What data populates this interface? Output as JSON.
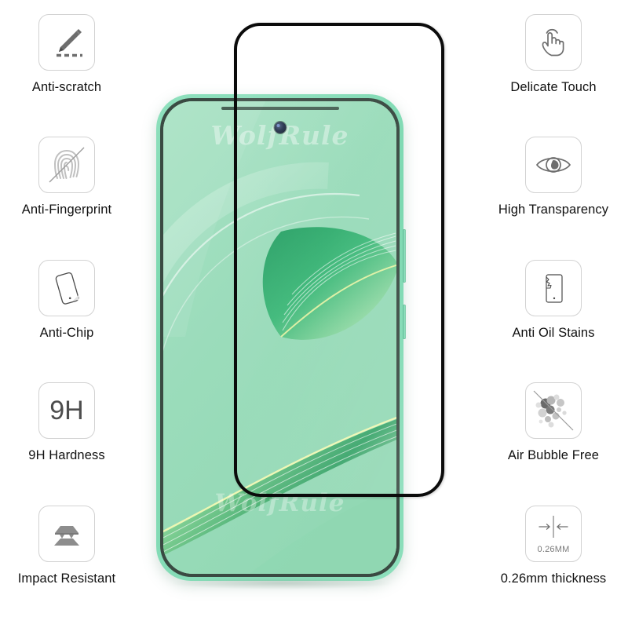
{
  "product": {
    "type": "tempered-glass-screen-protector",
    "brand_watermark": "WolfRule",
    "watermark_top": "WolfRule",
    "watermark_bottom": "WolfRule"
  },
  "colors": {
    "phone_green": "#8fe0bd",
    "screen_green": "#a5dfc0",
    "protector_edge": "#0b0b0b",
    "icon_border": "#d2d2d2",
    "icon_gray": "#6e6e6e",
    "label_text": "#111111"
  },
  "left_features": [
    {
      "icon": "scratch-pen-icon",
      "label": "Anti-scratch"
    },
    {
      "icon": "fingerprint-icon",
      "label": "Anti-Fingerprint"
    },
    {
      "icon": "phone-chip-icon",
      "label": "Anti-Chip"
    },
    {
      "icon": "hardness-9h-icon",
      "label": "9H Hardness",
      "badge": "9H"
    },
    {
      "icon": "impact-layers-icon",
      "label": "Impact Resistant"
    }
  ],
  "right_features": [
    {
      "icon": "touch-hand-icon",
      "label": "Delicate Touch"
    },
    {
      "icon": "eye-icon",
      "label": "High Transparency"
    },
    {
      "icon": "oil-stain-phone-icon",
      "label": "Anti Oil Stains"
    },
    {
      "icon": "air-bubble-icon",
      "label": "Air Bubble Free"
    },
    {
      "icon": "thickness-icon",
      "label": "0.26mm thickness",
      "badge": "0.26MM"
    }
  ]
}
